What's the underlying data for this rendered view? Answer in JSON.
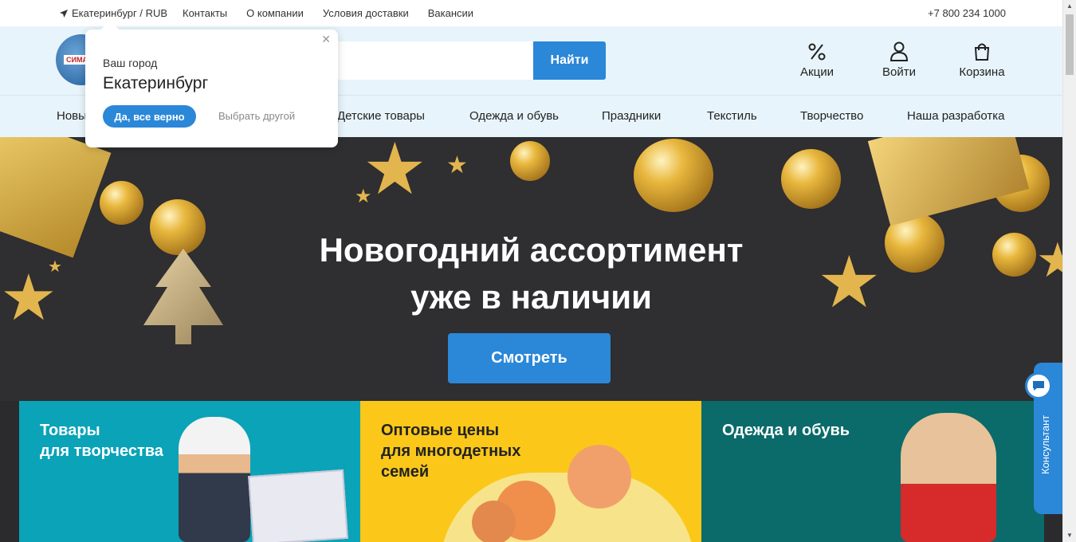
{
  "topbar": {
    "location": "Екатеринбург / RUB",
    "links": [
      "Контакты",
      "О компании",
      "Условия доставки",
      "Вакансии"
    ],
    "phone": "+7 800 234 1000"
  },
  "header": {
    "logo_text": "СИМА-",
    "search_placeholder": "",
    "search_button": "Найти",
    "promo_label": "Акции",
    "login_label": "Войти",
    "cart_label": "Корзина"
  },
  "nav": {
    "items": [
      "Новы",
      "Детские товары",
      "Одежда и обувь",
      "Праздники",
      "Текстиль",
      "Творчество",
      "Наша разработка"
    ]
  },
  "hero": {
    "title_line1": "Новогодний ассортимент",
    "title_line2": "уже в наличии",
    "button": "Смотреть"
  },
  "cards": [
    {
      "title": "Товары\nдля творчества",
      "bg": "#0aa3b8"
    },
    {
      "title": "Оптовые цены\nдля многодетных\nсемей",
      "bg": "#fbc81a"
    },
    {
      "title": "Одежда и обувь",
      "bg": "#0b6a6a"
    }
  ],
  "city_popup": {
    "label": "Ваш город",
    "city": "Екатеринбург",
    "confirm": "Да, все верно",
    "choose_other": "Выбрать другой"
  },
  "consultant": {
    "label": "Консультант"
  },
  "colors": {
    "accent": "#2b87d8",
    "header_bg": "#e8f4fb"
  }
}
